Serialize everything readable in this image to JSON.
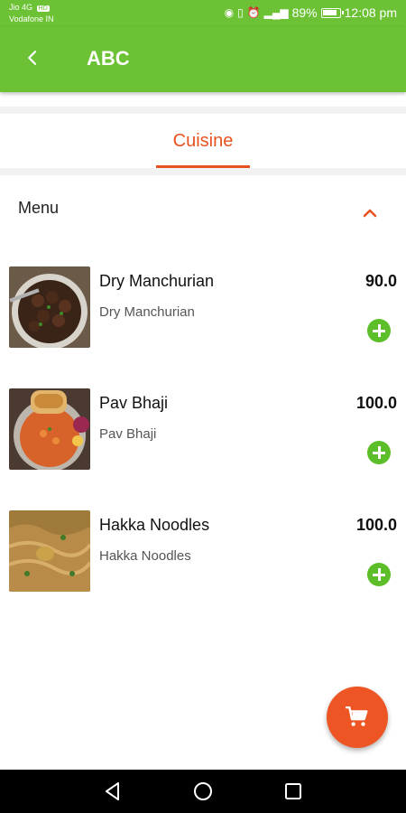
{
  "status_bar": {
    "carrier_line1": "Jio 4G",
    "carrier_badge": "HD",
    "carrier_line2": "Vodafone IN",
    "battery_percent": "89%",
    "time": "12:08 pm"
  },
  "app_bar": {
    "title": "ABC",
    "back_icon": "back-arrow-icon"
  },
  "tabs": [
    {
      "label": "Cuisine",
      "selected": true
    }
  ],
  "menu": {
    "label": "Menu",
    "expanded": true,
    "items": [
      {
        "name": "Dry Manchurian",
        "description": "Dry Manchurian",
        "price": "90.0"
      },
      {
        "name": "Pav Bhaji",
        "description": "Pav Bhaji",
        "price": "100.0"
      },
      {
        "name": "Hakka Noodles",
        "description": "Hakka Noodles",
        "price": "100.0"
      }
    ]
  },
  "fab": {
    "icon": "cart-icon"
  },
  "colors": {
    "primary": "#6cc234",
    "accent": "#e8521f",
    "add_button": "#5cbf2a",
    "fab": "#ee5524"
  }
}
